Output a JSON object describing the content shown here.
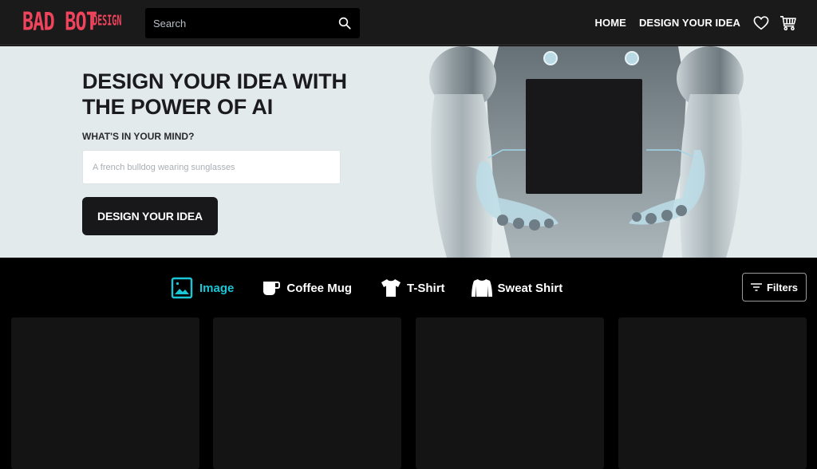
{
  "header": {
    "logo_main": "BAD BOT",
    "logo_sub": "DESIGN",
    "brand_color": "#f0435c",
    "search": {
      "placeholder": "Search",
      "value": "",
      "icon": "search-icon"
    },
    "nav": [
      {
        "label": "HOME"
      },
      {
        "label": "DESIGN YOUR IDEA"
      }
    ],
    "icons": [
      "heart-icon",
      "cart-icon"
    ]
  },
  "hero": {
    "title": "DESIGN YOUR IDEA WITH THE POWER OF AI",
    "prompt_label": "WHAT'S IN YOUR MIND?",
    "prompt_input": {
      "placeholder": "A french bulldog wearing sunglasses",
      "value": ""
    },
    "cta_label": "DESIGN YOUR IDEA",
    "background_color": "#e2eaec"
  },
  "categories": {
    "accent_color": "#1bc6d6",
    "tabs": [
      {
        "label": "Image",
        "icon": "image-icon",
        "active": true
      },
      {
        "label": "Coffee Mug",
        "icon": "mug-icon",
        "active": false
      },
      {
        "label": "T-Shirt",
        "icon": "tshirt-icon",
        "active": false
      },
      {
        "label": "Sweat Shirt",
        "icon": "sweatshirt-icon",
        "active": false
      }
    ],
    "filters_label": "Filters"
  },
  "products": {
    "cards_count": 4
  }
}
